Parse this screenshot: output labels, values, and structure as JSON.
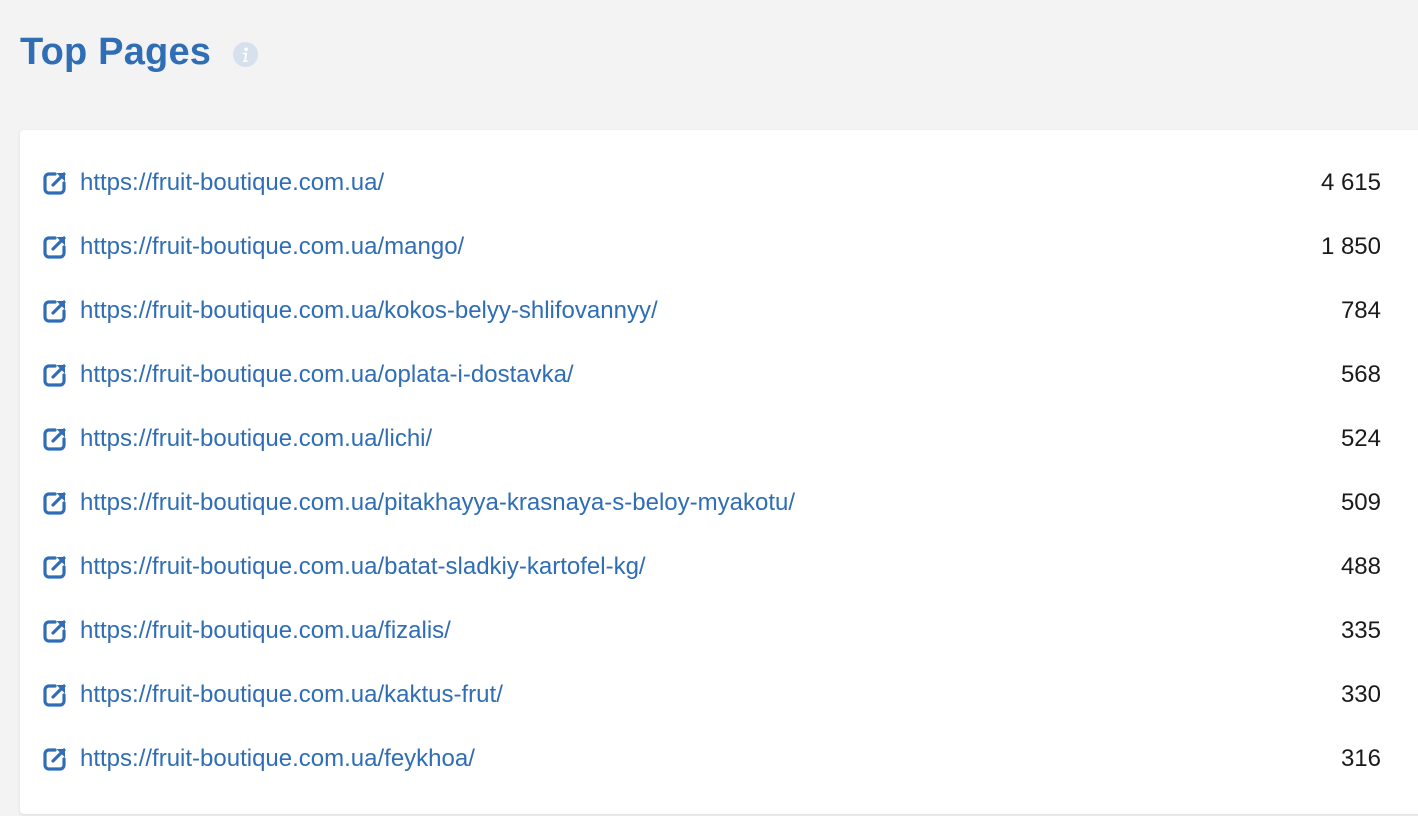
{
  "header": {
    "title": "Top Pages",
    "info_icon": "info-icon"
  },
  "colors": {
    "accent": "#2f6db5",
    "background": "#f3f3f3",
    "card": "#ffffff",
    "info_icon": "#d7e1ee",
    "count_text": "#1a1a1a"
  },
  "pages": [
    {
      "url": "https://fruit-boutique.com.ua/",
      "count": "4 615",
      "icon": "external-link-icon"
    },
    {
      "url": "https://fruit-boutique.com.ua/mango/",
      "count": "1 850",
      "icon": "external-link-icon"
    },
    {
      "url": "https://fruit-boutique.com.ua/kokos-belyy-shlifovannyy/",
      "count": "784",
      "icon": "external-link-icon"
    },
    {
      "url": "https://fruit-boutique.com.ua/oplata-i-dostavka/",
      "count": "568",
      "icon": "external-link-icon"
    },
    {
      "url": "https://fruit-boutique.com.ua/lichi/",
      "count": "524",
      "icon": "external-link-icon"
    },
    {
      "url": "https://fruit-boutique.com.ua/pitakhayya-krasnaya-s-beloy-myakotu/",
      "count": "509",
      "icon": "external-link-icon"
    },
    {
      "url": "https://fruit-boutique.com.ua/batat-sladkiy-kartofel-kg/",
      "count": "488",
      "icon": "external-link-icon"
    },
    {
      "url": "https://fruit-boutique.com.ua/fizalis/",
      "count": "335",
      "icon": "external-link-icon"
    },
    {
      "url": "https://fruit-boutique.com.ua/kaktus-frut/",
      "count": "330",
      "icon": "external-link-icon"
    },
    {
      "url": "https://fruit-boutique.com.ua/feykhoa/",
      "count": "316",
      "icon": "external-link-icon"
    }
  ]
}
